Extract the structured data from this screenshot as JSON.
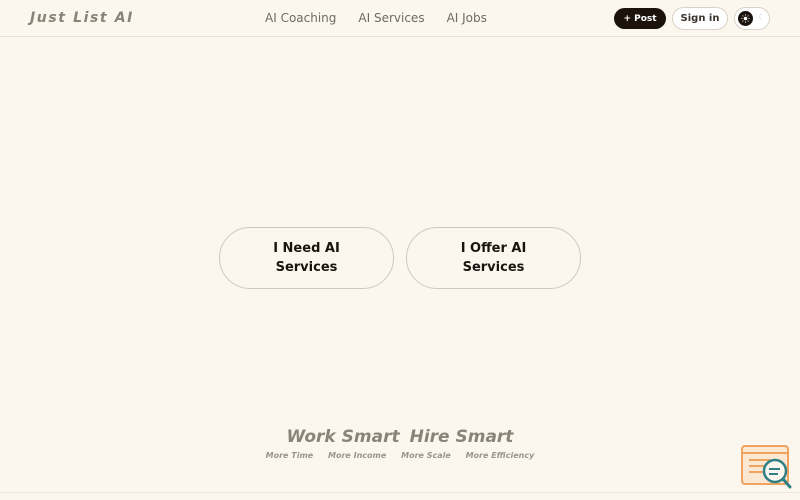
{
  "header": {
    "logo": "Just List AI",
    "nav": [
      {
        "label": "AI Coaching"
      },
      {
        "label": "AI Services"
      },
      {
        "label": "AI Jobs"
      }
    ],
    "post_label": "+ Post",
    "signin_label": "Sign in",
    "theme_toggle": {
      "knob_icon": "sun-icon",
      "alt_icon": "moon-icon"
    }
  },
  "main": {
    "need_label": "I Need AI Services",
    "offer_label": "I Offer AI Services"
  },
  "footer": {
    "tagline_1": "Work Smart",
    "tagline_2": "Hire Smart",
    "benefits": [
      "More Time",
      "More Income",
      "More Scale",
      "More Efficiency"
    ]
  },
  "widget": {
    "icon": "search-document-icon",
    "accent": "#f0a35e",
    "lens_color": "#2f7f86"
  },
  "colors": {
    "background": "#fcf7ee",
    "primary": "#1c120c",
    "muted": "#8a8478"
  }
}
